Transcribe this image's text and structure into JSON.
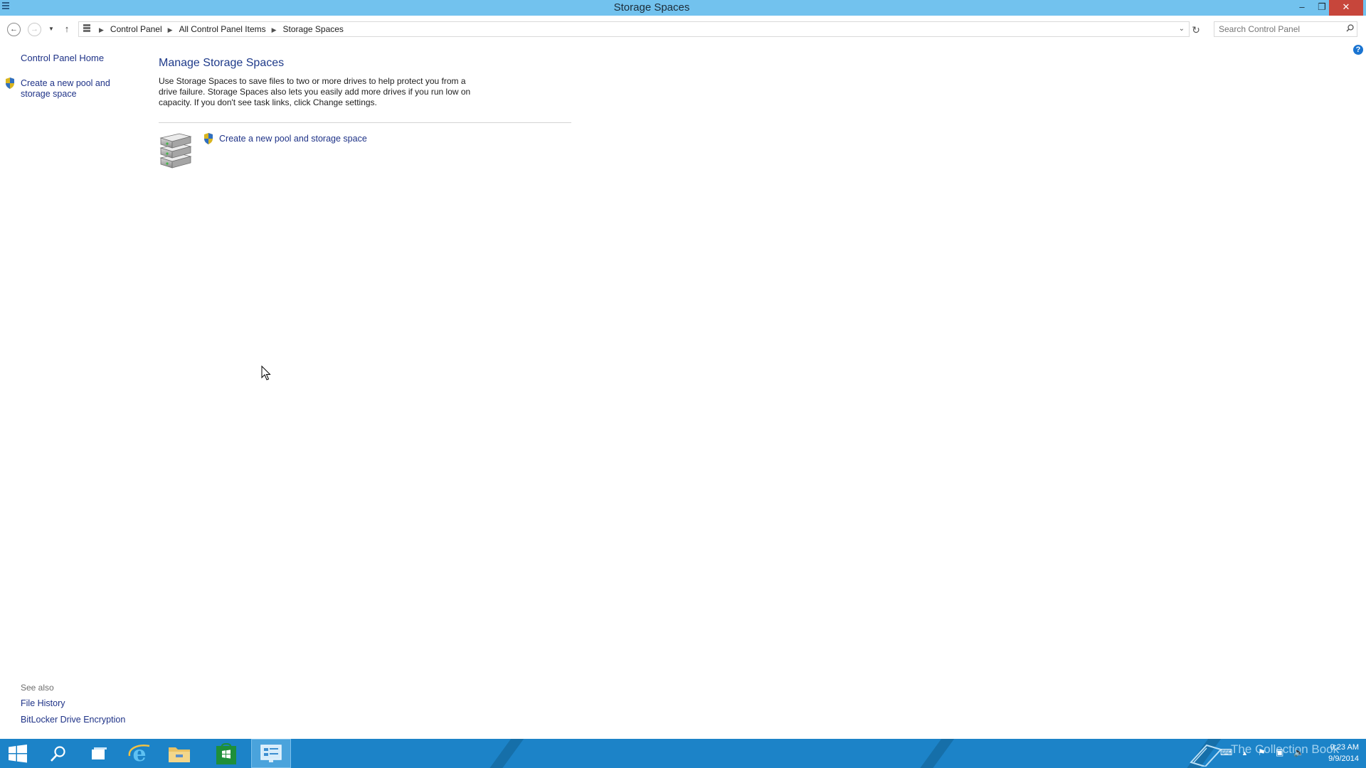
{
  "window": {
    "title": "Storage Spaces",
    "minimize_glyph": "–",
    "maximize_glyph": "❐",
    "close_glyph": "✕"
  },
  "navigation": {
    "back_icon": "back-arrow-icon",
    "forward_icon": "forward-arrow-icon",
    "recent_icon": "chevron-down-icon",
    "up_icon": "up-arrow-icon",
    "breadcrumbs": [
      "Control Panel",
      "All Control Panel Items",
      "Storage Spaces"
    ],
    "refresh_icon": "refresh-icon",
    "search_placeholder": "Search Control Panel"
  },
  "left_pane": {
    "home_link": "Control Panel Home",
    "task_link": "Create a new pool and storage space",
    "see_also_heading": "See also",
    "see_also_links": [
      "File History",
      "BitLocker Drive Encryption"
    ]
  },
  "main": {
    "heading": "Manage Storage Spaces",
    "description": "Use Storage Spaces to save files to two or more drives to help protect you from a drive failure. Storage Spaces also lets you easily add more drives if you run low on capacity. If you don't see task links, click Change settings.",
    "action_link": "Create a new pool and storage space",
    "help_glyph": "?"
  },
  "taskbar": {
    "pinned": [
      "start-button",
      "search-button",
      "task-view-button",
      "internet-explorer",
      "file-explorer",
      "store",
      "control-panel"
    ],
    "active_item": "control-panel",
    "watermark": "The Collection Book",
    "clock_time": "9:23 AM",
    "clock_date": "9/9/2014"
  },
  "colors": {
    "titlebar": "#72c2ee",
    "link": "#1e3287",
    "heading": "#1e3a8a",
    "taskbar": "#1c83c8",
    "close_button": "#c7463b"
  }
}
